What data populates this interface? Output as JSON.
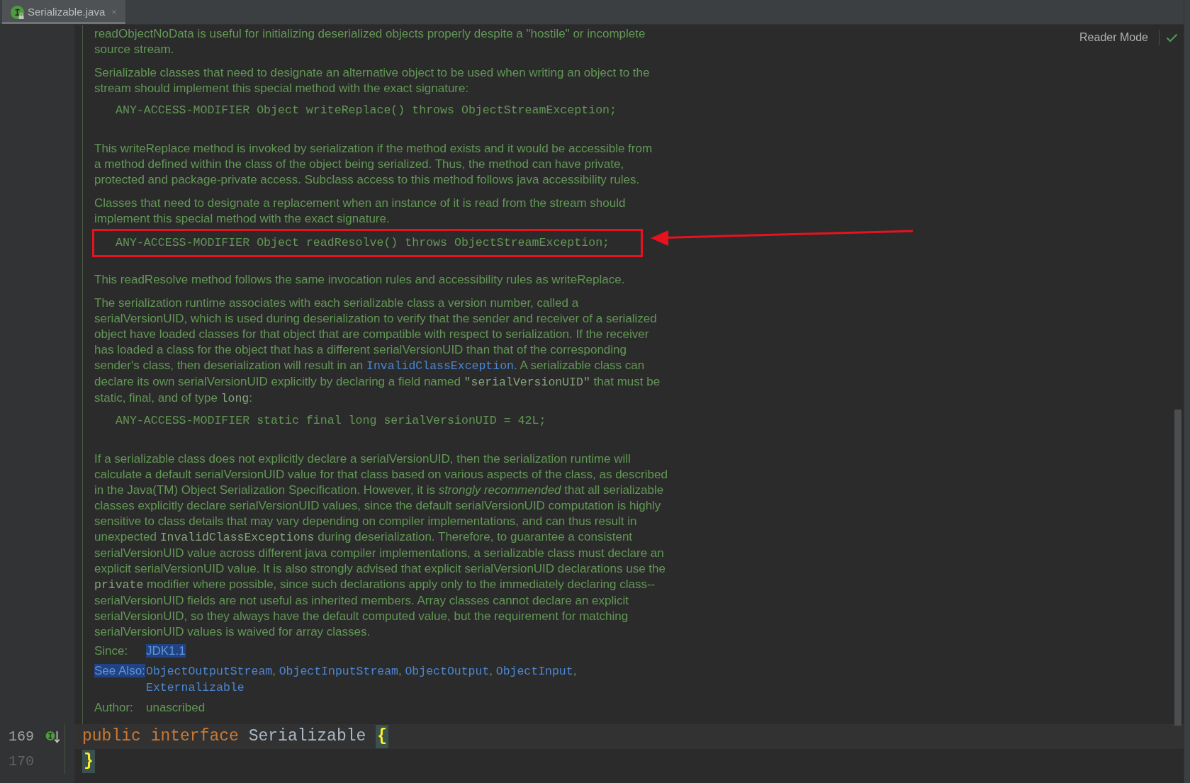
{
  "tabs": [
    {
      "title": "Serializable.java",
      "selected": true,
      "read_only": true
    }
  ],
  "reader_mode": {
    "label": "Reader Mode"
  },
  "doc": {
    "blocks": [
      {
        "kind": "paragraph",
        "lines": [
          "readObjectNoData is useful for initializing deserialized objects properly despite a \"hostile\" or incomplete",
          "source stream."
        ]
      },
      {
        "kind": "paragraph",
        "lines": [
          "Serializable classes that need to designate an alternative object to be used when writing an object to the",
          "stream should implement this special method with the exact signature:"
        ]
      },
      {
        "kind": "code",
        "text": "ANY-ACCESS-MODIFIER Object writeReplace() throws ObjectStreamException;",
        "annotated": false
      },
      {
        "kind": "paragraph",
        "lines": [
          "This writeReplace method is invoked by serialization if the method exists and it would be accessible from",
          "a method defined within the class of the object being serialized. Thus, the method can have private,",
          "protected and package-private access. Subclass access to this method follows java accessibility rules."
        ]
      },
      {
        "kind": "paragraph",
        "lines": [
          "Classes that need to designate a replacement when an instance of it is read from the stream should",
          "implement this special method with the exact signature."
        ]
      },
      {
        "kind": "code",
        "text": "ANY-ACCESS-MODIFIER Object readResolve() throws ObjectStreamException;",
        "annotated": true
      },
      {
        "kind": "paragraph",
        "lines": [
          "This readResolve method follows the same invocation rules and accessibility rules as writeReplace."
        ]
      },
      {
        "kind": "paragraph",
        "lines": [
          "The serialization runtime associates with each serializable class a version number, called a",
          "serialVersionUID, which is used during deserialization to verify that the sender and receiver of a serialized",
          "object have loaded classes for that object that are compatible with respect to serialization. If the receiver",
          "has loaded a class for the object that has a different serialVersionUID than that of the corresponding",
          [
            {
              "kind": "text",
              "text": "sender's class, then deserialization will result in an "
            },
            {
              "kind": "link",
              "text": "InvalidClassException"
            },
            {
              "kind": "text",
              "text": ". A serializable class can"
            }
          ],
          [
            {
              "kind": "text",
              "text": "declare its own serialVersionUID explicitly by declaring a field named "
            },
            {
              "kind": "code",
              "text": "\"serialVersionUID\""
            },
            {
              "kind": "text",
              "text": " that must be"
            }
          ],
          [
            {
              "kind": "text",
              "text": "static, final, and of type "
            },
            {
              "kind": "code",
              "text": "long"
            },
            {
              "kind": "text",
              "text": ":"
            }
          ]
        ]
      },
      {
        "kind": "code",
        "text": "ANY-ACCESS-MODIFIER static final long serialVersionUID = 42L;",
        "annotated": false
      },
      {
        "kind": "paragraph",
        "lines": [
          "If a serializable class does not explicitly declare a serialVersionUID, then the serialization runtime will",
          "calculate a default serialVersionUID value for that class based on various aspects of the class, as described",
          "in the Java(TM) Object Serialization Specification. However, it is *strongly recommended* that all serializable",
          "classes explicitly declare serialVersionUID values, since the default serialVersionUID computation is highly",
          "sensitive to class details that may vary depending on compiler implementations, and can thus result in",
          [
            {
              "kind": "text",
              "text": "unexpected "
            },
            {
              "kind": "code",
              "text": "InvalidClassExceptions"
            },
            {
              "kind": "text",
              "text": " during deserialization. Therefore, to guarantee a consistent"
            }
          ],
          "serialVersionUID value across different java compiler implementations, a serializable class must declare an",
          "explicit serialVersionUID value. It is also strongly advised that explicit serialVersionUID declarations use the",
          [
            {
              "kind": "code",
              "text": "private"
            },
            {
              "kind": "text",
              "text": " modifier where possible, since such declarations apply only to the immediately declaring class--"
            }
          ],
          "serialVersionUID fields are not useful as inherited members. Array classes cannot declare an explicit",
          "serialVersionUID, so they always have the default computed value, but the requirement for matching",
          "serialVersionUID values is waived for array classes."
        ]
      }
    ]
  },
  "tags": [
    {
      "label": "Since:",
      "label_highlighted": false,
      "lines": [
        [
          {
            "kind": "text",
            "text": "JDK1.1",
            "highlighted": true
          }
        ]
      ]
    },
    {
      "label": "See Also:",
      "label_highlighted": true,
      "lines": [
        [
          {
            "kind": "link",
            "text": "ObjectOutputStream",
            "highlighted": false
          },
          {
            "kind": "text",
            "text": ", ",
            "highlighted": false
          },
          {
            "kind": "link",
            "text": "ObjectInputStream",
            "highlighted": false
          },
          {
            "kind": "text",
            "text": ", ",
            "highlighted": false
          },
          {
            "kind": "link",
            "text": "ObjectOutput",
            "highlighted": false
          },
          {
            "kind": "text",
            "text": ", ",
            "highlighted": false
          },
          {
            "kind": "link",
            "text": "ObjectInput",
            "highlighted": false
          },
          {
            "kind": "text",
            "text": ",",
            "highlighted": false
          }
        ],
        [
          {
            "kind": "link",
            "text": "Externalizable",
            "highlighted": false
          }
        ]
      ]
    },
    {
      "label": "Author:",
      "label_highlighted": false,
      "lines": [
        [
          {
            "kind": "text",
            "text": "unascribed",
            "highlighted": false
          }
        ]
      ]
    }
  ],
  "code_lines": [
    {
      "number": "169",
      "current": true,
      "gutter_icon": true,
      "tokens": [
        {
          "kind": "keyword",
          "text": "public"
        },
        {
          "kind": "keyword",
          "text": "interface"
        },
        {
          "kind": "identifier",
          "text": "Serializable"
        },
        {
          "kind": "brace",
          "text": "{",
          "matched": true
        }
      ]
    },
    {
      "number": "170",
      "current": false,
      "gutter_icon": false,
      "tokens": [
        {
          "kind": "brace",
          "text": "}",
          "matched": true
        }
      ]
    }
  ]
}
